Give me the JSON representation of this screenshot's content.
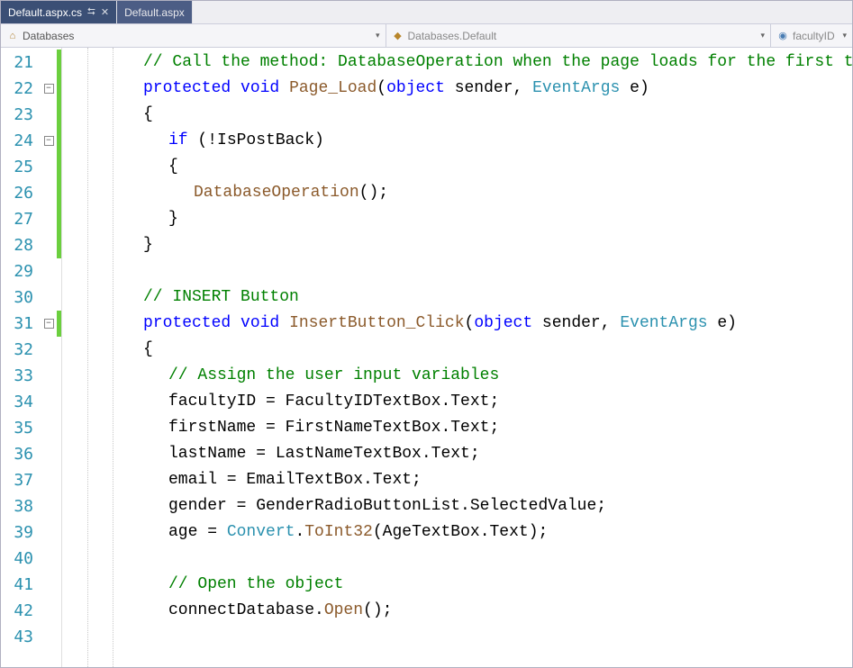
{
  "tabs": [
    {
      "label": "Default.aspx.cs",
      "active": true,
      "pinned": true,
      "closable": true
    },
    {
      "label": "Default.aspx",
      "active": false,
      "pinned": false,
      "closable": false
    }
  ],
  "nav": {
    "namespace": "Databases",
    "class": "Databases.Default",
    "member": "facultyID"
  },
  "code": {
    "first_line": 21,
    "change_markers": [
      21,
      22,
      23,
      24,
      25,
      26,
      27,
      28,
      31
    ],
    "fold_markers": {
      "22": "-",
      "24": "-",
      "31": "-"
    },
    "lines": [
      {
        "n": 21,
        "indent": 3,
        "tokens": [
          [
            "comment",
            "// Call the method: DatabaseOperation when the page loads for the first time"
          ]
        ]
      },
      {
        "n": 22,
        "indent": 3,
        "tokens": [
          [
            "keyword",
            "protected"
          ],
          [
            "text",
            " "
          ],
          [
            "keyword",
            "void"
          ],
          [
            "text",
            " "
          ],
          [
            "ident",
            "Page_Load"
          ],
          [
            "text",
            "("
          ],
          [
            "keyword",
            "object"
          ],
          [
            "text",
            " sender, "
          ],
          [
            "type",
            "EventArgs"
          ],
          [
            "text",
            " e)"
          ]
        ]
      },
      {
        "n": 23,
        "indent": 3,
        "tokens": [
          [
            "text",
            "{"
          ]
        ]
      },
      {
        "n": 24,
        "indent": 4,
        "tokens": [
          [
            "keyword",
            "if"
          ],
          [
            "text",
            " (!IsPostBack)"
          ]
        ]
      },
      {
        "n": 25,
        "indent": 4,
        "tokens": [
          [
            "text",
            "{"
          ]
        ]
      },
      {
        "n": 26,
        "indent": 5,
        "tokens": [
          [
            "ident",
            "DatabaseOperation"
          ],
          [
            "text",
            "();"
          ]
        ]
      },
      {
        "n": 27,
        "indent": 4,
        "tokens": [
          [
            "text",
            "}"
          ]
        ]
      },
      {
        "n": 28,
        "indent": 3,
        "tokens": [
          [
            "text",
            "}"
          ]
        ]
      },
      {
        "n": 29,
        "indent": 0,
        "tokens": []
      },
      {
        "n": 30,
        "indent": 3,
        "tokens": [
          [
            "comment",
            "// INSERT Button"
          ]
        ]
      },
      {
        "n": 31,
        "indent": 3,
        "tokens": [
          [
            "keyword",
            "protected"
          ],
          [
            "text",
            " "
          ],
          [
            "keyword",
            "void"
          ],
          [
            "text",
            " "
          ],
          [
            "ident",
            "InsertButton_Click"
          ],
          [
            "text",
            "("
          ],
          [
            "keyword",
            "object"
          ],
          [
            "text",
            " sender, "
          ],
          [
            "type",
            "EventArgs"
          ],
          [
            "text",
            " e)"
          ]
        ]
      },
      {
        "n": 32,
        "indent": 3,
        "tokens": [
          [
            "text",
            "{"
          ]
        ]
      },
      {
        "n": 33,
        "indent": 4,
        "tokens": [
          [
            "comment",
            "// Assign the user input variables"
          ]
        ]
      },
      {
        "n": 34,
        "indent": 4,
        "tokens": [
          [
            "text",
            "facultyID = FacultyIDTextBox.Text;"
          ]
        ]
      },
      {
        "n": 35,
        "indent": 4,
        "tokens": [
          [
            "text",
            "firstName = FirstNameTextBox.Text;"
          ]
        ]
      },
      {
        "n": 36,
        "indent": 4,
        "tokens": [
          [
            "text",
            "lastName = LastNameTextBox.Text;"
          ]
        ]
      },
      {
        "n": 37,
        "indent": 4,
        "tokens": [
          [
            "text",
            "email = EmailTextBox.Text;"
          ]
        ]
      },
      {
        "n": 38,
        "indent": 4,
        "tokens": [
          [
            "text",
            "gender = GenderRadioButtonList.SelectedValue;"
          ]
        ]
      },
      {
        "n": 39,
        "indent": 4,
        "tokens": [
          [
            "text",
            "age = "
          ],
          [
            "type",
            "Convert"
          ],
          [
            "text",
            "."
          ],
          [
            "ident",
            "ToInt32"
          ],
          [
            "text",
            "(AgeTextBox.Text);"
          ]
        ]
      },
      {
        "n": 40,
        "indent": 0,
        "tokens": []
      },
      {
        "n": 41,
        "indent": 4,
        "tokens": [
          [
            "comment",
            "// Open the object"
          ]
        ]
      },
      {
        "n": 42,
        "indent": 4,
        "tokens": [
          [
            "text",
            "connectDatabase."
          ],
          [
            "ident",
            "Open"
          ],
          [
            "text",
            "();"
          ]
        ]
      },
      {
        "n": 43,
        "indent": 0,
        "tokens": []
      }
    ]
  }
}
